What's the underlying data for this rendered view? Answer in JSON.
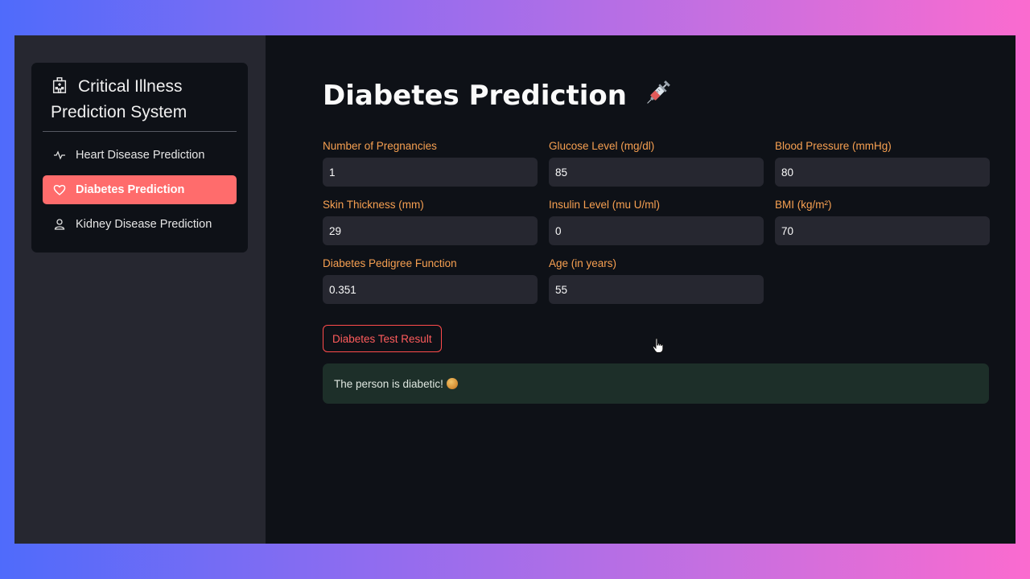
{
  "sidebar": {
    "title": "Critical Illness Prediction System",
    "items": [
      {
        "label": "Heart Disease Prediction",
        "icon": "activity-icon",
        "active": false
      },
      {
        "label": "Diabetes Prediction",
        "icon": "heart-icon",
        "active": true
      },
      {
        "label": "Kidney Disease Prediction",
        "icon": "person-icon",
        "active": false
      }
    ]
  },
  "main": {
    "title": "Diabetes Prediction",
    "title_icon": "syringe-icon",
    "fields": [
      {
        "label": "Number of Pregnancies",
        "value": "1"
      },
      {
        "label": "Glucose Level (mg/dl)",
        "value": "85"
      },
      {
        "label": "Blood Pressure (mmHg)",
        "value": "80"
      },
      {
        "label": "Skin Thickness (mm)",
        "value": "29"
      },
      {
        "label": "Insulin Level (mu U/ml)",
        "value": "0"
      },
      {
        "label": "BMI (kg/m²)",
        "value": "70"
      },
      {
        "label": "Diabetes Pedigree Function",
        "value": "0.351"
      },
      {
        "label": "Age (in years)",
        "value": "55"
      }
    ],
    "button_label": "Diabetes Test Result",
    "result_text": "The person is diabetic!",
    "result_icon": "cookie-emoji-icon"
  },
  "colors": {
    "accent": "#ff4b4b",
    "active_nav": "#ff6c6c",
    "label": "#f7a051",
    "input_bg": "#262730",
    "result_bg": "#1d2f29",
    "app_bg": "#0e1117",
    "sidebar_bg": "#262730"
  }
}
